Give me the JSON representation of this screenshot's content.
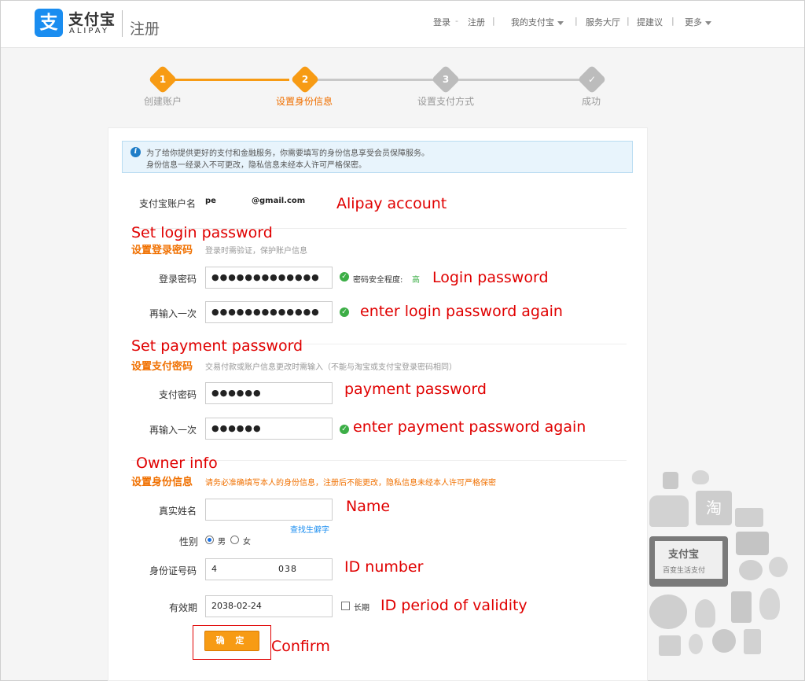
{
  "header": {
    "logo_zh": "支付宝",
    "logo_en": "ALIPAY",
    "page_title": "注册",
    "nav": {
      "login": "登录",
      "dash": "-",
      "register": "注册",
      "my_alipay": "我的支付宝",
      "service_hall": "服务大厅",
      "suggest": "提建议",
      "more": "更多"
    }
  },
  "steps": [
    {
      "num": "1",
      "label": "创建账户"
    },
    {
      "num": "2",
      "label": "设置身份信息"
    },
    {
      "num": "3",
      "label": "设置支付方式"
    },
    {
      "num": "✓",
      "label": "成功"
    }
  ],
  "notice": {
    "line1": "为了给你提供更好的支付和金融服务，你需要填写的身份信息享受会员保障服务。",
    "line2": "身份信息一经录入不可更改，隐私信息未经本人许可严格保密。"
  },
  "account": {
    "label": "支付宝账户名",
    "value_prefix": "pe",
    "value_suffix": "@gmail.com"
  },
  "login_section": {
    "title": "设置登录密码",
    "desc": "登录时需验证，保护账户信息",
    "password_label": "登录密码",
    "password_value": "●●●●●●●●●●●●●",
    "strength_label": "密码安全程度:",
    "strength_value": "高",
    "confirm_label": "再输入一次",
    "confirm_value": "●●●●●●●●●●●●●"
  },
  "payment_section": {
    "title": "设置支付密码",
    "desc": "交易付款或账户信息更改时需输入（不能与淘宝或支付宝登录密码相同）",
    "password_label": "支付密码",
    "password_value": "●●●●●●",
    "confirm_label": "再输入一次",
    "confirm_value": "●●●●●●"
  },
  "identity_section": {
    "title": "设置身份信息",
    "desc": "请务必准确填写本人的身份信息，注册后不能更改，隐私信息未经本人许可严格保密",
    "name_label": "真实姓名",
    "name_value": "",
    "lookup_link": "查找生僻字",
    "gender_label": "性别",
    "gender_male": "男",
    "gender_female": "女",
    "id_label": "身份证号码",
    "id_value_start": "4",
    "id_value_end": "038",
    "validity_label": "有效期",
    "validity_value": "2038-02-24",
    "long_term_label": "长期"
  },
  "confirm_button": "确 定",
  "annotations": {
    "alipay_account": "Alipay account",
    "set_login_password": "Set login password",
    "login_password": "Login password",
    "enter_login_again": "enter login password again",
    "set_payment_password": "Set payment password",
    "payment_password": "payment password",
    "enter_payment_again": "enter payment password again",
    "owner_info": "Owner info",
    "name": "Name",
    "id_number": "ID number",
    "id_validity": "ID period of validity",
    "confirm": "Confirm"
  },
  "illustration": {
    "brand": "支付宝",
    "slogan": "百变生活支付",
    "tao": "淘"
  },
  "colors": {
    "accent_orange": "#f79b14",
    "annotation_red": "#e00000",
    "brand_blue": "#1a8df0",
    "success_green": "#3cae46"
  }
}
